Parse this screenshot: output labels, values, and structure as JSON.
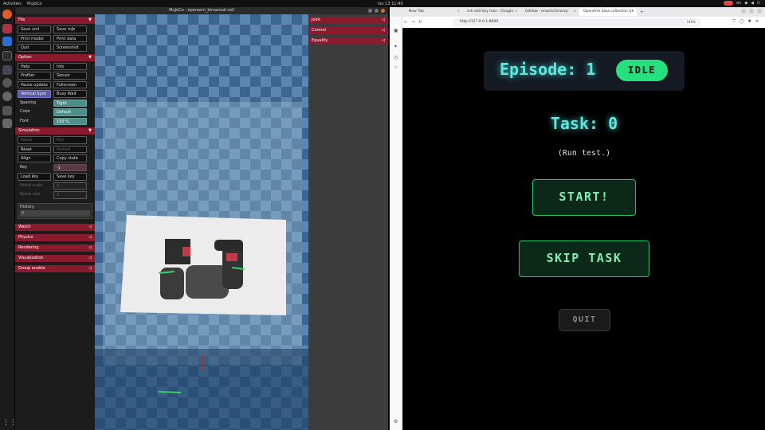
{
  "topbar": {
    "activities": "Activities",
    "app_name": "MuJoCo",
    "clock": "Ιαν 13  11:40",
    "tray_lang": "en"
  },
  "mujoco": {
    "window_title": "MuJoCo : openarm_bimanual cell",
    "sections": {
      "file": "File",
      "option": "Option",
      "simulation": "Simulation",
      "watch": "Watch",
      "physics": "Physics",
      "rendering": "Rendering",
      "visualization": "Visualization",
      "group_enable": "Group enable",
      "joint": "Joint",
      "control": "Control",
      "equality": "Equality"
    },
    "file_buttons": [
      "Save xml",
      "Save mjb",
      "Print model",
      "Print data",
      "Quit",
      "Screenshot"
    ],
    "option_buttons": [
      "Help",
      "Info",
      "Profiler",
      "Sensor",
      "Pause update",
      "Fullscreen",
      "Vertical Sync",
      "Busy Wait"
    ],
    "option_rows": [
      {
        "label": "Spacing",
        "value": "Tight"
      },
      {
        "label": "Color",
        "value": "Default"
      },
      {
        "label": "Font",
        "value": "150 %"
      }
    ],
    "sim_buttons": [
      "Pause",
      "Run",
      "Reset",
      "Reload",
      "Align",
      "Copy state"
    ],
    "sim_key": {
      "label": "Key",
      "value": "-1"
    },
    "sim_key_buttons": [
      "Load key",
      "Save key"
    ],
    "noise_scale": {
      "label": "Noise scale",
      "value": "0"
    },
    "noise_rate": {
      "label": "Noise rate",
      "value": "0"
    },
    "history": {
      "label": "History",
      "value": "0"
    },
    "arrow_open": "▼",
    "arrow_closed": "◁"
  },
  "browser": {
    "tabs": [
      {
        "title": "New Tab"
      },
      {
        "title": "ssh add key mac - Google"
      },
      {
        "title": "GitHub - enactic/lerarxp"
      },
      {
        "title": "OpenArm data collection UI"
      }
    ],
    "url": "http://127.0.0.1:8000",
    "zoom": "140%"
  },
  "app": {
    "episode_label": "Episode: 1",
    "status_badge": "IDLE",
    "task_label": "Task: 0",
    "subtitle": "(Run test.)",
    "start_button": "START!",
    "skip_button": "SKIP TASK",
    "quit_button": "QUIT"
  },
  "colors": {
    "accent_cyan": "#5ee8e0",
    "idle_green": "#25e07c",
    "button_green": "#22c46a",
    "mujoco_header": "#8a1a2e"
  }
}
